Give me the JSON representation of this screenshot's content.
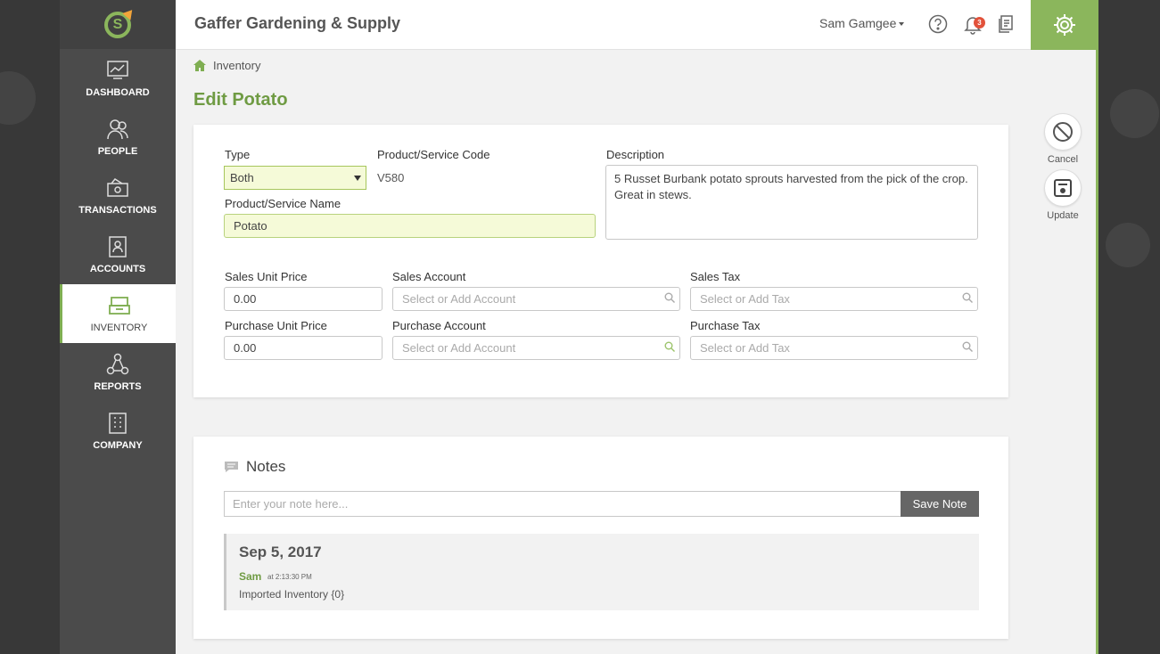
{
  "app": {
    "company_name": "Gaffer Gardening & Supply"
  },
  "colors": {
    "accent": "#8bb65c",
    "title": "#6f9b43",
    "sidebar": "#4b4b4b",
    "badge": "#e2523b"
  },
  "header": {
    "user_name": "Sam Gamgee",
    "notification_count": "3",
    "help_icon": "question-icon",
    "bell_icon": "bell-icon",
    "docs_icon": "documents-icon",
    "settings_icon": "gear-icon"
  },
  "sidebar": {
    "items": [
      {
        "label": "DASHBOARD",
        "icon": "chart-icon"
      },
      {
        "label": "PEOPLE",
        "icon": "people-icon"
      },
      {
        "label": "TRANSACTIONS",
        "icon": "transactions-icon"
      },
      {
        "label": "ACCOUNTS",
        "icon": "accounts-icon"
      },
      {
        "label": "INVENTORY",
        "icon": "inventory-icon",
        "active": true
      },
      {
        "label": "REPORTS",
        "icon": "reports-icon"
      },
      {
        "label": "COMPANY",
        "icon": "building-icon"
      }
    ]
  },
  "breadcrumb": {
    "label": "Inventory",
    "icon": "home-icon"
  },
  "page": {
    "title": "Edit Potato"
  },
  "form": {
    "type_label": "Type",
    "type_value": "Both",
    "code_label": "Product/Service Code",
    "code_value": "V580",
    "description_label": "Description",
    "description_value": "5 Russet Burbank potato sprouts harvested from the pick of the crop. Great in stews.",
    "name_label": "Product/Service Name",
    "name_value": "Potato",
    "sales_price_label": "Sales Unit Price",
    "sales_price_value": "0.00",
    "sales_account_label": "Sales Account",
    "sales_account_placeholder": "Select or Add Account",
    "sales_tax_label": "Sales Tax",
    "sales_tax_placeholder": "Select or Add Tax",
    "purchase_price_label": "Purchase Unit Price",
    "purchase_price_value": "0.00",
    "purchase_account_label": "Purchase Account",
    "purchase_account_placeholder": "Select or Add Account",
    "purchase_tax_label": "Purchase Tax",
    "purchase_tax_placeholder": "Select or Add Tax"
  },
  "actions": {
    "cancel_label": "Cancel",
    "update_label": "Update"
  },
  "notes": {
    "heading": "Notes",
    "input_placeholder": "Enter your note here...",
    "save_label": "Save Note",
    "entries": [
      {
        "date": "Sep 5, 2017",
        "user": "Sam",
        "time": "at 2:13:30 PM",
        "text": "Imported Inventory {0}"
      }
    ]
  }
}
